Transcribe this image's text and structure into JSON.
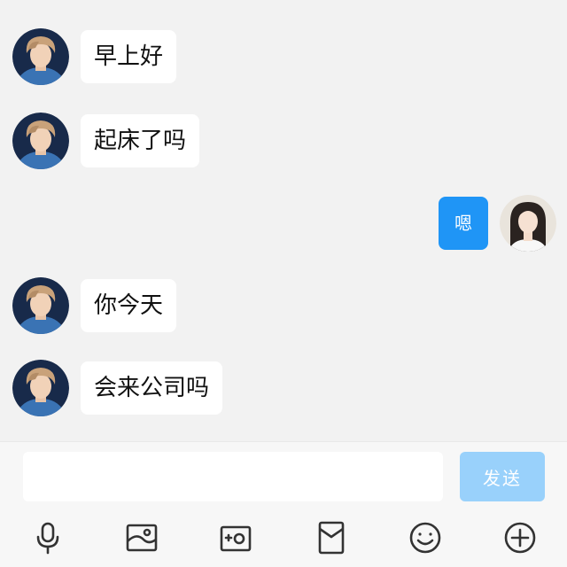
{
  "messages": [
    {
      "side": "left",
      "text": "早上好",
      "avatar": "male-avatar"
    },
    {
      "side": "left",
      "text": "起床了吗",
      "avatar": "male-avatar"
    },
    {
      "side": "right",
      "text": "嗯",
      "avatar": "female-avatar"
    },
    {
      "side": "left",
      "text": "你今天",
      "avatar": "male-avatar"
    },
    {
      "side": "left",
      "text": "会来公司吗",
      "avatar": "male-avatar"
    }
  ],
  "input": {
    "value": "",
    "placeholder": ""
  },
  "send_button": {
    "label": "发送"
  },
  "toolbar": {
    "icons": [
      "microphone-icon",
      "image-icon",
      "camera-icon",
      "red-packet-icon",
      "emoji-icon",
      "plus-icon"
    ]
  },
  "colors": {
    "background": "#f2f2f2",
    "bubble_left": "#ffffff",
    "bubble_right": "#1f95f6",
    "send_button": "#99d1fb",
    "icon": "#333333"
  }
}
